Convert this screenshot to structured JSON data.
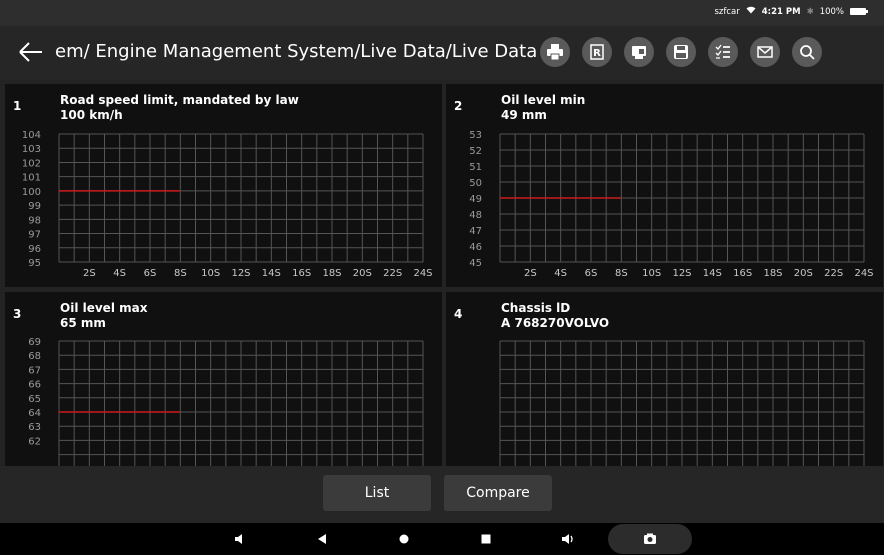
{
  "status": {
    "carrier": "szfcar",
    "time": "4:21 PM",
    "battery": "100%"
  },
  "header": {
    "title": "em/ Engine Management System/Live Data/Live Data",
    "tools": [
      "printer-icon",
      "report-icon",
      "record-icon",
      "save-icon",
      "checklist-icon",
      "mail-icon",
      "search-icon"
    ]
  },
  "panels": [
    {
      "num": "1",
      "name": "Road speed limit, mandated by law",
      "value": "100 km/h"
    },
    {
      "num": "2",
      "name": "Oil level min",
      "value": "49 mm"
    },
    {
      "num": "3",
      "name": "Oil level max",
      "value": "65 mm"
    },
    {
      "num": "4",
      "name": "Chassis lD",
      "value": "A 768270VOLVO"
    }
  ],
  "chart_data": [
    {
      "type": "line",
      "y_ticks": [
        "104",
        "103",
        "102",
        "101",
        "100",
        "99",
        "98",
        "97",
        "96",
        "95"
      ],
      "ylim": [
        95,
        104
      ],
      "x_ticks": [
        "2S",
        "4S",
        "6S",
        "8S",
        "10S",
        "12S",
        "14S",
        "16S",
        "18S",
        "20S",
        "22S",
        "24S"
      ],
      "xlim": [
        0,
        24
      ],
      "grid": true,
      "series": [
        {
          "x": [
            0,
            8
          ],
          "y": [
            100,
            100
          ],
          "color": "#cc1a1a"
        }
      ]
    },
    {
      "type": "line",
      "y_ticks": [
        "53",
        "52",
        "51",
        "50",
        "49",
        "48",
        "47",
        "46",
        "45"
      ],
      "ylim": [
        45,
        53
      ],
      "x_ticks": [
        "2S",
        "4S",
        "6S",
        "8S",
        "10S",
        "12S",
        "14S",
        "16S",
        "18S",
        "20S",
        "22S",
        "24S"
      ],
      "xlim": [
        0,
        24
      ],
      "grid": true,
      "series": [
        {
          "x": [
            0,
            8
          ],
          "y": [
            49,
            49
          ],
          "color": "#cc1a1a"
        }
      ]
    },
    {
      "type": "line",
      "y_ticks": [
        "69",
        "68",
        "67",
        "66",
        "65",
        "64",
        "63",
        "62"
      ],
      "ylim": [
        61,
        69
      ],
      "x_ticks": [],
      "xlim": [
        0,
        24
      ],
      "grid": true,
      "series": [
        {
          "x": [
            0,
            8
          ],
          "y": [
            64,
            64
          ],
          "color": "#cc1a1a"
        }
      ]
    },
    {
      "type": "line",
      "y_ticks": [],
      "ylim": [
        0,
        10
      ],
      "x_ticks": [],
      "xlim": [
        0,
        24
      ],
      "grid": true,
      "series": []
    }
  ],
  "bottom": {
    "list_label": "List",
    "compare_label": "Compare"
  },
  "navbar": [
    "volume-down-icon",
    "back-triangle-icon",
    "home-circle-icon",
    "recents-square-icon",
    "volume-up-icon",
    "camera-icon"
  ]
}
